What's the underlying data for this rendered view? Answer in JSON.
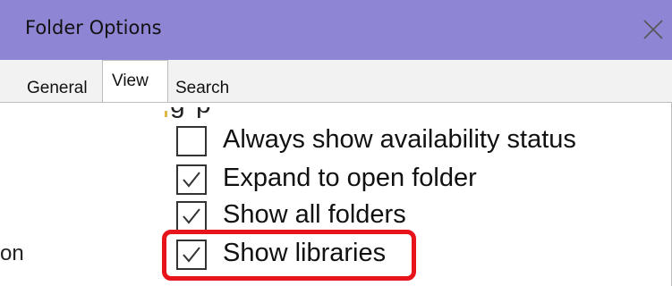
{
  "window": {
    "title": "Folder Options",
    "close_icon": "close-icon"
  },
  "tabs": [
    {
      "label": "General",
      "selected": false
    },
    {
      "label": "View",
      "selected": true
    },
    {
      "label": "Search",
      "selected": false
    }
  ],
  "options": [
    {
      "label": "Always show availability status",
      "checked": false
    },
    {
      "label": "Expand to open folder",
      "checked": true
    },
    {
      "label": "Show all folders",
      "checked": true
    },
    {
      "label": "Show libraries",
      "checked": true
    }
  ],
  "cutoff_text": "g   p",
  "stray_text": "on",
  "colors": {
    "titlebar": "#8e86d4",
    "highlight": "#e8141b",
    "tab_selected": "#ffffff",
    "tab_strip": "#f2f2f2"
  },
  "highlighted_option": "Show libraries"
}
